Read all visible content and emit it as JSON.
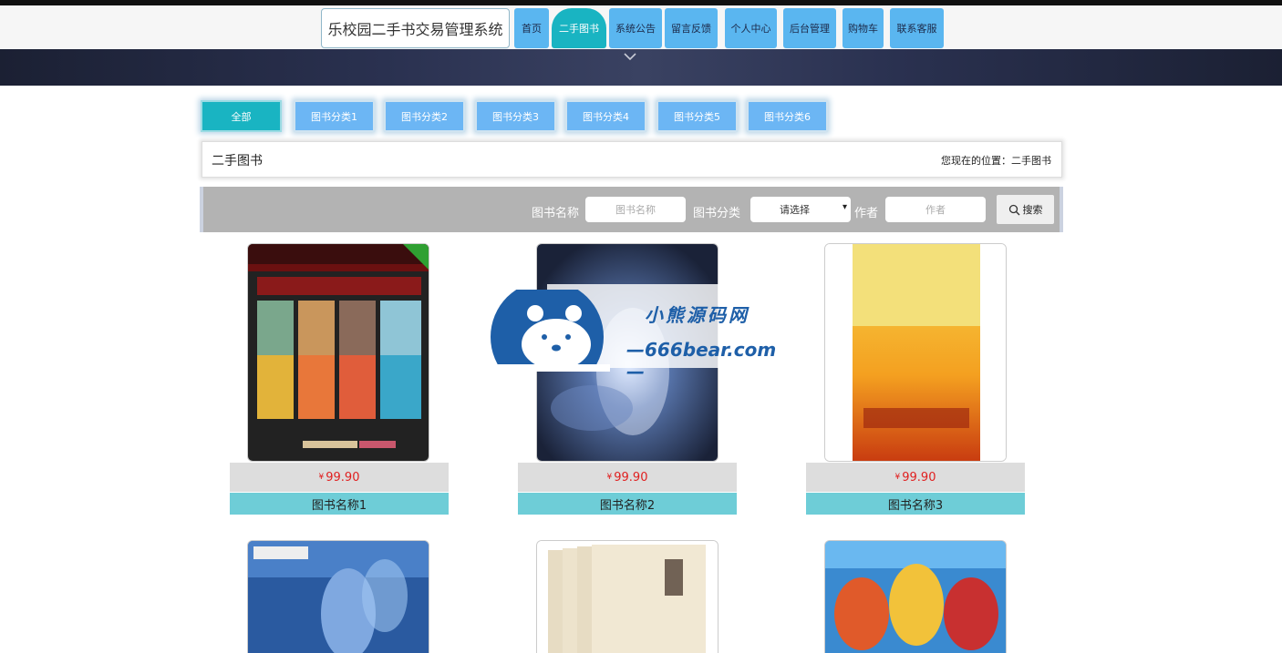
{
  "header": {
    "site_title": "乐校园二手书交易管理系统",
    "nav": [
      {
        "label": "首页",
        "active": false
      },
      {
        "label": "二手图书",
        "active": true
      },
      {
        "label": "系统公告",
        "active": false
      },
      {
        "label": "留言反馈",
        "active": false
      },
      {
        "label": "个人中心",
        "active": false
      },
      {
        "label": "后台管理",
        "active": false
      },
      {
        "label": "购物车",
        "active": false
      },
      {
        "label": "联系客服",
        "active": false
      }
    ]
  },
  "categories": [
    {
      "label": "全部",
      "active": true
    },
    {
      "label": "图书分类1",
      "active": false
    },
    {
      "label": "图书分类2",
      "active": false
    },
    {
      "label": "图书分类3",
      "active": false
    },
    {
      "label": "图书分类4",
      "active": false
    },
    {
      "label": "图书分类5",
      "active": false
    },
    {
      "label": "图书分类6",
      "active": false
    }
  ],
  "breadcrumb": {
    "title": "二手图书",
    "location": "您现在的位置：二手图书"
  },
  "search": {
    "name_label": "图书名称",
    "name_placeholder": "图书名称",
    "category_label": "图书分类",
    "category_value": "请选择",
    "author_label": "作者",
    "author_placeholder": "作者",
    "button_label": "搜索"
  },
  "books": [
    {
      "name": "图书名称1",
      "currency": "¥",
      "price": "99.90"
    },
    {
      "name": "图书名称2",
      "currency": "¥",
      "price": "99.90"
    },
    {
      "name": "图书名称3",
      "currency": "¥",
      "price": "99.90"
    }
  ],
  "watermark": {
    "brand": "小熊源码网",
    "url": "—666bear.com—"
  },
  "colors": {
    "accent": "#19b4c2",
    "nav_blue": "#5ab6f0",
    "price_red": "#e02020",
    "name_bar": "#6ecdd7"
  }
}
